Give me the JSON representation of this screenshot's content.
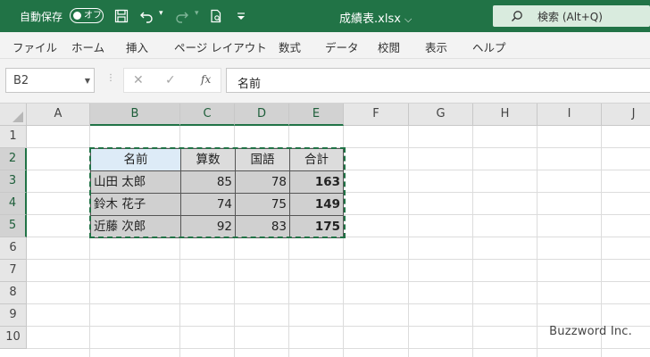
{
  "titlebar": {
    "autosave_label": "自動保存",
    "autosave_state": "オフ",
    "filename": "成績表.xlsx",
    "search_label": "検索 (Alt+Q)"
  },
  "menu": [
    "ファイル",
    "ホーム",
    "挿入",
    "ページ レイアウト",
    "数式",
    "データ",
    "校閲",
    "表示",
    "ヘルプ"
  ],
  "formula_bar": {
    "name_box": "B2",
    "fx_label": "fx",
    "formula": "名前"
  },
  "columns": [
    "A",
    "B",
    "C",
    "D",
    "E",
    "F",
    "G",
    "H",
    "I",
    "J"
  ],
  "rows": [
    "1",
    "2",
    "3",
    "4",
    "5",
    "6",
    "7",
    "8",
    "9",
    "10"
  ],
  "table": {
    "headers": [
      "名前",
      "算数",
      "国語",
      "合計"
    ],
    "rows": [
      [
        "山田 太郎",
        "85",
        "78",
        "163"
      ],
      [
        "鈴木 花子",
        "74",
        "75",
        "149"
      ],
      [
        "近藤 次郎",
        "92",
        "83",
        "175"
      ]
    ]
  },
  "watermark": "Buzzword Inc.",
  "colors": {
    "accent": "#217346",
    "search_bg": "#d9ebde",
    "header_cell_bg": "#ddebf7"
  }
}
